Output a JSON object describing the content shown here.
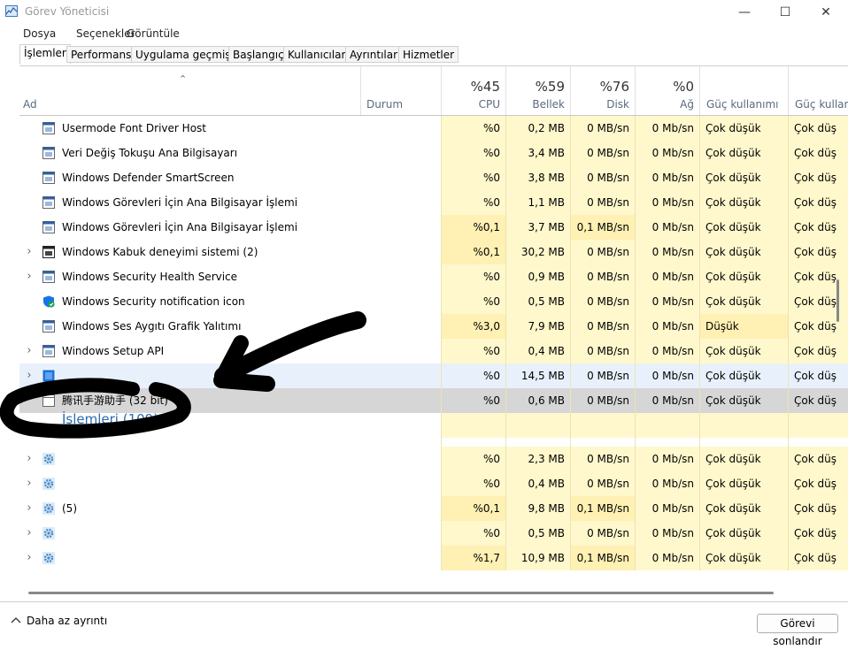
{
  "window": {
    "title": "Görev Yöneticisi",
    "minimize_glyph": "—",
    "maximize_glyph": "☐",
    "close_glyph": "✕"
  },
  "menu": [
    "Dosya",
    "Seçenekler",
    "Görüntüle"
  ],
  "tabs": [
    {
      "label": "İşlemler",
      "active": true
    },
    {
      "label": "Performans"
    },
    {
      "label": "Uygulama geçmişi"
    },
    {
      "label": "Başlangıç"
    },
    {
      "label": "Kullanıcılar"
    },
    {
      "label": "Ayrıntılar"
    },
    {
      "label": "Hizmetler"
    }
  ],
  "columns": {
    "name": "Ad",
    "status": "Durum",
    "cpu": {
      "pct": "%45",
      "label": "CPU"
    },
    "memory": {
      "pct": "%59",
      "label": "Bellek"
    },
    "disk": {
      "pct": "%76",
      "label": "Disk"
    },
    "network": {
      "pct": "%0",
      "label": "Ağ"
    },
    "power": "Güç kullanımı",
    "power_trend": "Güç kullanı"
  },
  "sort_glyph": "⌃",
  "processes": [
    {
      "name": "Usermode Font Driver Host",
      "icon": "window-icon",
      "expand": false,
      "cpu": "%0",
      "mem": "0,2 MB",
      "disk": "0 MB/sn",
      "net": "0 Mb/sn",
      "power": "Çok düşük",
      "power_trend": "Çok düş"
    },
    {
      "name": "Veri Değiş Tokuşu Ana Bilgisayarı",
      "icon": "window-icon",
      "expand": false,
      "cpu": "%0",
      "mem": "3,4 MB",
      "disk": "0 MB/sn",
      "net": "0 Mb/sn",
      "power": "Çok düşük",
      "power_trend": "Çok düş"
    },
    {
      "name": "Windows Defender SmartScreen",
      "icon": "window-icon",
      "expand": false,
      "cpu": "%0",
      "mem": "3,8 MB",
      "disk": "0 MB/sn",
      "net": "0 Mb/sn",
      "power": "Çok düşük",
      "power_trend": "Çok düş"
    },
    {
      "name": "Windows Görevleri İçin Ana Bilgisayar İşlemi",
      "icon": "window-icon",
      "expand": false,
      "cpu": "%0",
      "mem": "1,1 MB",
      "disk": "0 MB/sn",
      "net": "0 Mb/sn",
      "power": "Çok düşük",
      "power_trend": "Çok düş"
    },
    {
      "name": "Windows Görevleri İçin Ana Bilgisayar İşlemi",
      "icon": "window-icon",
      "expand": false,
      "cpu": "%0,1",
      "mem": "3,7 MB",
      "disk": "0,1 MB/sn",
      "net": "0 Mb/sn",
      "power": "Çok düşük",
      "power_trend": "Çok düş"
    },
    {
      "name": "Windows Kabuk deneyimi sistemi (2)",
      "icon": "window-dark-icon",
      "expand": true,
      "cpu": "%0,1",
      "mem": "30,2 MB",
      "disk": "0 MB/sn",
      "net": "0 Mb/sn",
      "power": "Çok düşük",
      "power_trend": "Çok düş"
    },
    {
      "name": "Windows Security Health Service",
      "icon": "window-icon",
      "expand": true,
      "cpu": "%0",
      "mem": "0,9 MB",
      "disk": "0 MB/sn",
      "net": "0 Mb/sn",
      "power": "Çok düşük",
      "power_trend": "Çok düş"
    },
    {
      "name": "Windows Security notification icon",
      "icon": "shield-check-icon",
      "expand": false,
      "cpu": "%0",
      "mem": "0,5 MB",
      "disk": "0 MB/sn",
      "net": "0 Mb/sn",
      "power": "Çok düşük",
      "power_trend": "Çok düş"
    },
    {
      "name": "Windows Ses Aygıtı Grafik Yalıtımı",
      "icon": "window-icon",
      "expand": false,
      "cpu": "%3,0",
      "mem": "7,9 MB",
      "disk": "0 MB/sn",
      "net": "0 Mb/sn",
      "power": "Düşük",
      "power_trend": "Çok düş"
    },
    {
      "name": "Windows Setup API",
      "icon": "window-icon",
      "expand": true,
      "cpu": "%0",
      "mem": "0,4 MB",
      "disk": "0 MB/sn",
      "net": "0 Mb/sn",
      "power": "Çok düşük",
      "power_trend": "Çok düş"
    },
    {
      "name": "",
      "icon": "app-blue-icon",
      "expand": true,
      "cpu": "%0",
      "mem": "14,5 MB",
      "disk": "0 MB/sn",
      "net": "0 Mb/sn",
      "power": "Çok düşük",
      "power_trend": "Çok düş"
    },
    {
      "name": "腾讯手游助手 (32 bit)",
      "icon": "blank-window-icon",
      "expand": false,
      "cpu": "%0",
      "mem": "0,6 MB",
      "disk": "0 MB/sn",
      "net": "0 Mb/sn",
      "power": "Çok düşük",
      "power_trend": "Çok düş"
    }
  ],
  "group": {
    "label": "İşlemleri (109)"
  },
  "background_processes": [
    {
      "name": "",
      "icon": "gear-icon",
      "expand": true,
      "cpu": "%0",
      "mem": "2,3 MB",
      "disk": "0 MB/sn",
      "net": "0 Mb/sn",
      "power": "Çok düşük",
      "power_trend": "Çok düş"
    },
    {
      "name": "",
      "icon": "gear-icon",
      "expand": true,
      "cpu": "%0",
      "mem": "0,4 MB",
      "disk": "0 MB/sn",
      "net": "0 Mb/sn",
      "power": "Çok düşük",
      "power_trend": "Çok düş"
    },
    {
      "name": "(5)",
      "icon": "gear-icon",
      "expand": true,
      "cpu": "%0,1",
      "mem": "9,8 MB",
      "disk": "0,1 MB/sn",
      "net": "0 Mb/sn",
      "power": "Çok düşük",
      "power_trend": "Çok düş"
    },
    {
      "name": "",
      "icon": "gear-icon",
      "expand": true,
      "cpu": "%0",
      "mem": "0,5 MB",
      "disk": "0 MB/sn",
      "net": "0 Mb/sn",
      "power": "Çok düşük",
      "power_trend": "Çok düş"
    },
    {
      "name": "",
      "icon": "gear-icon",
      "expand": true,
      "cpu": "%1,7",
      "mem": "10,9 MB",
      "disk": "0,1 MB/sn",
      "net": "0 Mb/sn",
      "power": "Çok düşük",
      "power_trend": "Çok düş"
    }
  ],
  "footer": {
    "fewer_details": "Daha az ayrıntı",
    "end_task": "Görevi sonlandır"
  },
  "colors": {
    "heat_light": "#fff8cc",
    "heat_med": "#fff0b3",
    "heat_high": "#ffe89a",
    "selected": "#d6d6d6",
    "hover": "#e8f1fb",
    "group_text": "#2b6cb0",
    "ink": "#000000"
  }
}
